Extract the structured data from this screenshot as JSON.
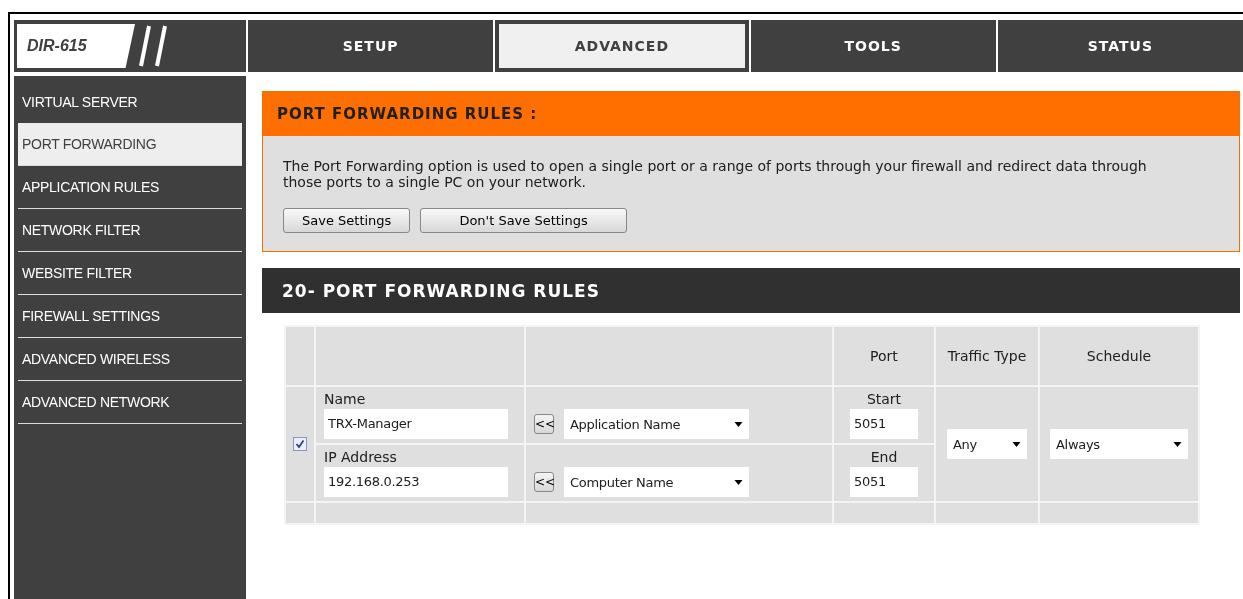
{
  "logo": {
    "model": "DIR-615"
  },
  "tabs": [
    {
      "label": "SETUP",
      "selected": false
    },
    {
      "label": "ADVANCED",
      "selected": true
    },
    {
      "label": "TOOLS",
      "selected": false
    },
    {
      "label": "STATUS",
      "selected": false
    }
  ],
  "sidebar": {
    "items": [
      {
        "label": "VIRTUAL SERVER",
        "selected": false
      },
      {
        "label": "PORT FORWARDING",
        "selected": true
      },
      {
        "label": "APPLICATION RULES",
        "selected": false
      },
      {
        "label": "NETWORK FILTER",
        "selected": false
      },
      {
        "label": "WEBSITE FILTER",
        "selected": false
      },
      {
        "label": "FIREWALL SETTINGS",
        "selected": false
      },
      {
        "label": "ADVANCED WIRELESS",
        "selected": false
      },
      {
        "label": "ADVANCED NETWORK",
        "selected": false
      }
    ]
  },
  "intro": {
    "title": "PORT FORWARDING RULES :",
    "text": "The Port Forwarding option is used to open a single port or a range of ports through your firewall and redirect data through those ports to a single PC on your network.",
    "buttons": [
      "Save Settings",
      "Don't Save Settings"
    ]
  },
  "rules": {
    "title": "20- PORT FORWARDING RULES",
    "columns": [
      "Port",
      "Traffic Type",
      "Schedule"
    ],
    "rows": [
      {
        "enabled": true,
        "name_label": "Name",
        "name": "TRX-Manager",
        "name_copy": "<<",
        "app_select": "Application Name",
        "ip_label": "IP Address",
        "ip": "192.168.0.253",
        "ip_copy": "<<",
        "computer_select": "Computer Name",
        "start_label": "Start",
        "start": "5051",
        "end_label": "End",
        "end": "5051",
        "traffic": "Any",
        "schedule": "Always"
      }
    ]
  }
}
